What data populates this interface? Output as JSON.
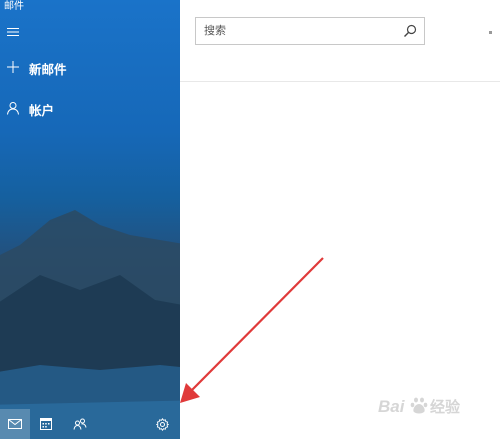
{
  "app": {
    "title": "邮件"
  },
  "nav": {
    "new_mail_label": "新邮件",
    "accounts_label": "帐户"
  },
  "bottom_bar": {
    "items": [
      "mail-icon",
      "calendar-icon",
      "people-icon",
      "settings-icon"
    ],
    "active": "mail-icon"
  },
  "search": {
    "placeholder": "搜索",
    "value": ""
  },
  "colors": {
    "nav_blue": "#1a73c9",
    "arrow": "#e03a3a",
    "search_border": "#c8c8c8"
  },
  "watermark": {
    "text": "Bai 经验",
    "brand": "baidu"
  }
}
